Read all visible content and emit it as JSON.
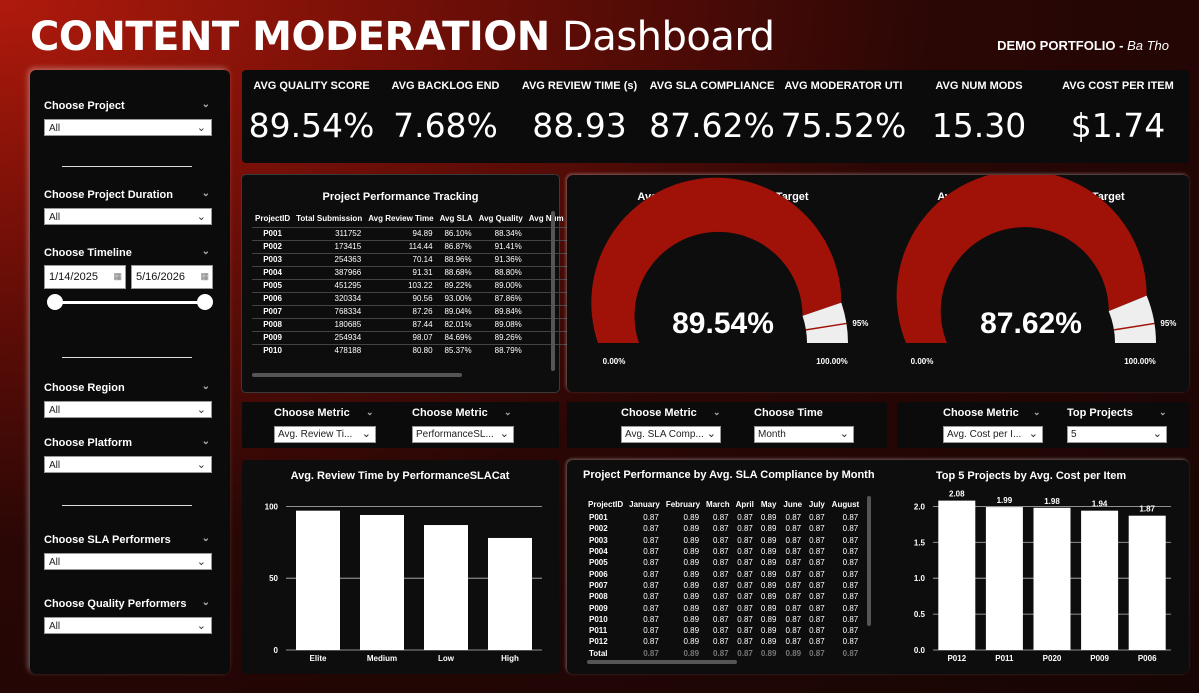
{
  "header": {
    "title_bold": "CONTENT MODERATION",
    "title_rest": "Dashboard",
    "portfolio": "DEMO PORTFOLIO -",
    "author": "Ba Tho"
  },
  "sidebar": {
    "project": {
      "label": "Choose Project",
      "value": "All"
    },
    "duration": {
      "label": "Choose Project Duration",
      "value": "All"
    },
    "timeline": {
      "label": "Choose Timeline",
      "start": "1/14/2025",
      "end": "5/16/2026"
    },
    "region": {
      "label": "Choose Region",
      "value": "All"
    },
    "platform": {
      "label": "Choose Platform",
      "value": "All"
    },
    "sla": {
      "label": "Choose SLA Performers",
      "value": "All"
    },
    "quality": {
      "label": "Choose Quality Performers",
      "value": "All"
    }
  },
  "kpis": [
    {
      "label": "AVG QUALITY SCORE",
      "value": "89.54%"
    },
    {
      "label": "AVG BACKLOG END",
      "value": "7.68%"
    },
    {
      "label": "AVG REVIEW TIME (s)",
      "value": "88.93"
    },
    {
      "label": "AVG SLA COMPLIANCE",
      "value": "87.62%"
    },
    {
      "label": "AVG MODERATOR UTI",
      "value": "75.52%"
    },
    {
      "label": "AVG NUM MODS",
      "value": "15.30"
    },
    {
      "label": "AVG COST PER ITEM",
      "value": "$1.74"
    }
  ],
  "project_table": {
    "title": "Project Performance Tracking",
    "columns": [
      "ProjectID",
      "Total Submission",
      "Avg Review Time",
      "Avg SLA",
      "Avg Quality",
      "Avg Num"
    ],
    "rows": [
      [
        "P001",
        "311752",
        "94.89",
        "86.10%",
        "88.34%"
      ],
      [
        "P002",
        "173415",
        "114.44",
        "86.87%",
        "91.41%"
      ],
      [
        "P003",
        "254363",
        "70.14",
        "88.96%",
        "91.36%"
      ],
      [
        "P004",
        "387966",
        "91.31",
        "88.68%",
        "88.80%"
      ],
      [
        "P005",
        "451295",
        "103.22",
        "89.22%",
        "89.00%"
      ],
      [
        "P006",
        "320334",
        "90.56",
        "93.00%",
        "87.86%"
      ],
      [
        "P007",
        "768334",
        "87.26",
        "89.04%",
        "89.84%"
      ],
      [
        "P008",
        "180685",
        "87.44",
        "82.01%",
        "89.08%"
      ],
      [
        "P009",
        "254934",
        "98.07",
        "84.69%",
        "89.26%"
      ],
      [
        "P010",
        "478188",
        "80.80",
        "85.37%",
        "88.79%"
      ]
    ]
  },
  "gauges": [
    {
      "title": "Average Quality Score vs. Target",
      "value_text": "89.54%",
      "value": 89.54,
      "target": 95,
      "target_text": "95%",
      "min_text": "0.00%",
      "max_text": "100.00%"
    },
    {
      "title": "Average SLA Compliance vs. Target",
      "value_text": "87.62%",
      "value": 87.62,
      "target": 95,
      "target_text": "95%",
      "min_text": "0.00%",
      "max_text": "100.00%"
    }
  ],
  "filters": {
    "metric1": {
      "label": "Choose Metric",
      "value": "Avg. Review Ti..."
    },
    "metric2": {
      "label": "Choose Metric",
      "value": "PerformanceSL..."
    },
    "metric3": {
      "label": "Choose Metric",
      "value": "Avg. SLA Comp..."
    },
    "time": {
      "label": "Choose Time",
      "value": "Month"
    },
    "metric4": {
      "label": "Choose Metric",
      "value": "Avg. Cost per I..."
    },
    "top": {
      "label": "Top Projects",
      "value": "5"
    }
  },
  "colors": {
    "accent": "#a01208",
    "gauge_rest": "#eeeeee",
    "bar": "#ffffff",
    "target_line": "#a01208"
  },
  "chart_data": [
    {
      "type": "bar",
      "title": "Avg. Review Time by PerformanceSLACat",
      "categories": [
        "Elite",
        "Medium",
        "Low",
        "High"
      ],
      "values": [
        97,
        94,
        87,
        78
      ],
      "yticks": [
        0,
        50,
        100
      ],
      "ylim": [
        0,
        110
      ],
      "grid": true
    },
    {
      "type": "bar",
      "title": "Top 5 Projects by Avg. Cost per Item",
      "categories": [
        "P012",
        "P011",
        "P020",
        "P009",
        "P006"
      ],
      "values": [
        2.08,
        1.99,
        1.98,
        1.94,
        1.87
      ],
      "labels": [
        "2.08",
        "1.99",
        "1.98",
        "1.94",
        "1.87"
      ],
      "yticks": [
        "0.0",
        "0.5",
        "1.0",
        "1.5",
        "2.0"
      ],
      "ylim": [
        0,
        2.2
      ],
      "grid": true
    }
  ],
  "matrix": {
    "title": "Project Performance by Avg. SLA Compliance by Month",
    "columns": [
      "ProjectID",
      "January",
      "February",
      "March",
      "April",
      "May",
      "June",
      "July",
      "August"
    ],
    "rows": [
      [
        "P001",
        "0.87",
        "0.89",
        "0.87",
        "0.87",
        "0.89",
        "0.87",
        "0.87",
        "0.87"
      ],
      [
        "P002",
        "0.87",
        "0.89",
        "0.87",
        "0.87",
        "0.89",
        "0.87",
        "0.87",
        "0.87"
      ],
      [
        "P003",
        "0.87",
        "0.89",
        "0.87",
        "0.87",
        "0.89",
        "0.87",
        "0.87",
        "0.87"
      ],
      [
        "P004",
        "0.87",
        "0.89",
        "0.87",
        "0.87",
        "0.89",
        "0.87",
        "0.87",
        "0.87"
      ],
      [
        "P005",
        "0.87",
        "0.89",
        "0.87",
        "0.87",
        "0.89",
        "0.87",
        "0.87",
        "0.87"
      ],
      [
        "P006",
        "0.87",
        "0.89",
        "0.87",
        "0.87",
        "0.89",
        "0.87",
        "0.87",
        "0.87"
      ],
      [
        "P007",
        "0.87",
        "0.89",
        "0.87",
        "0.87",
        "0.89",
        "0.87",
        "0.87",
        "0.87"
      ],
      [
        "P008",
        "0.87",
        "0.89",
        "0.87",
        "0.87",
        "0.89",
        "0.87",
        "0.87",
        "0.87"
      ],
      [
        "P009",
        "0.87",
        "0.89",
        "0.87",
        "0.87",
        "0.89",
        "0.87",
        "0.87",
        "0.87"
      ],
      [
        "P010",
        "0.87",
        "0.89",
        "0.87",
        "0.87",
        "0.89",
        "0.87",
        "0.87",
        "0.87"
      ],
      [
        "P011",
        "0.87",
        "0.89",
        "0.87",
        "0.87",
        "0.89",
        "0.87",
        "0.87",
        "0.87"
      ],
      [
        "P012",
        "0.87",
        "0.89",
        "0.87",
        "0.87",
        "0.89",
        "0.87",
        "0.87",
        "0.87"
      ]
    ],
    "total": [
      "Total",
      "0.87",
      "0.89",
      "0.87",
      "0.87",
      "0.89",
      "0.89",
      "0.87",
      "0.87"
    ]
  }
}
